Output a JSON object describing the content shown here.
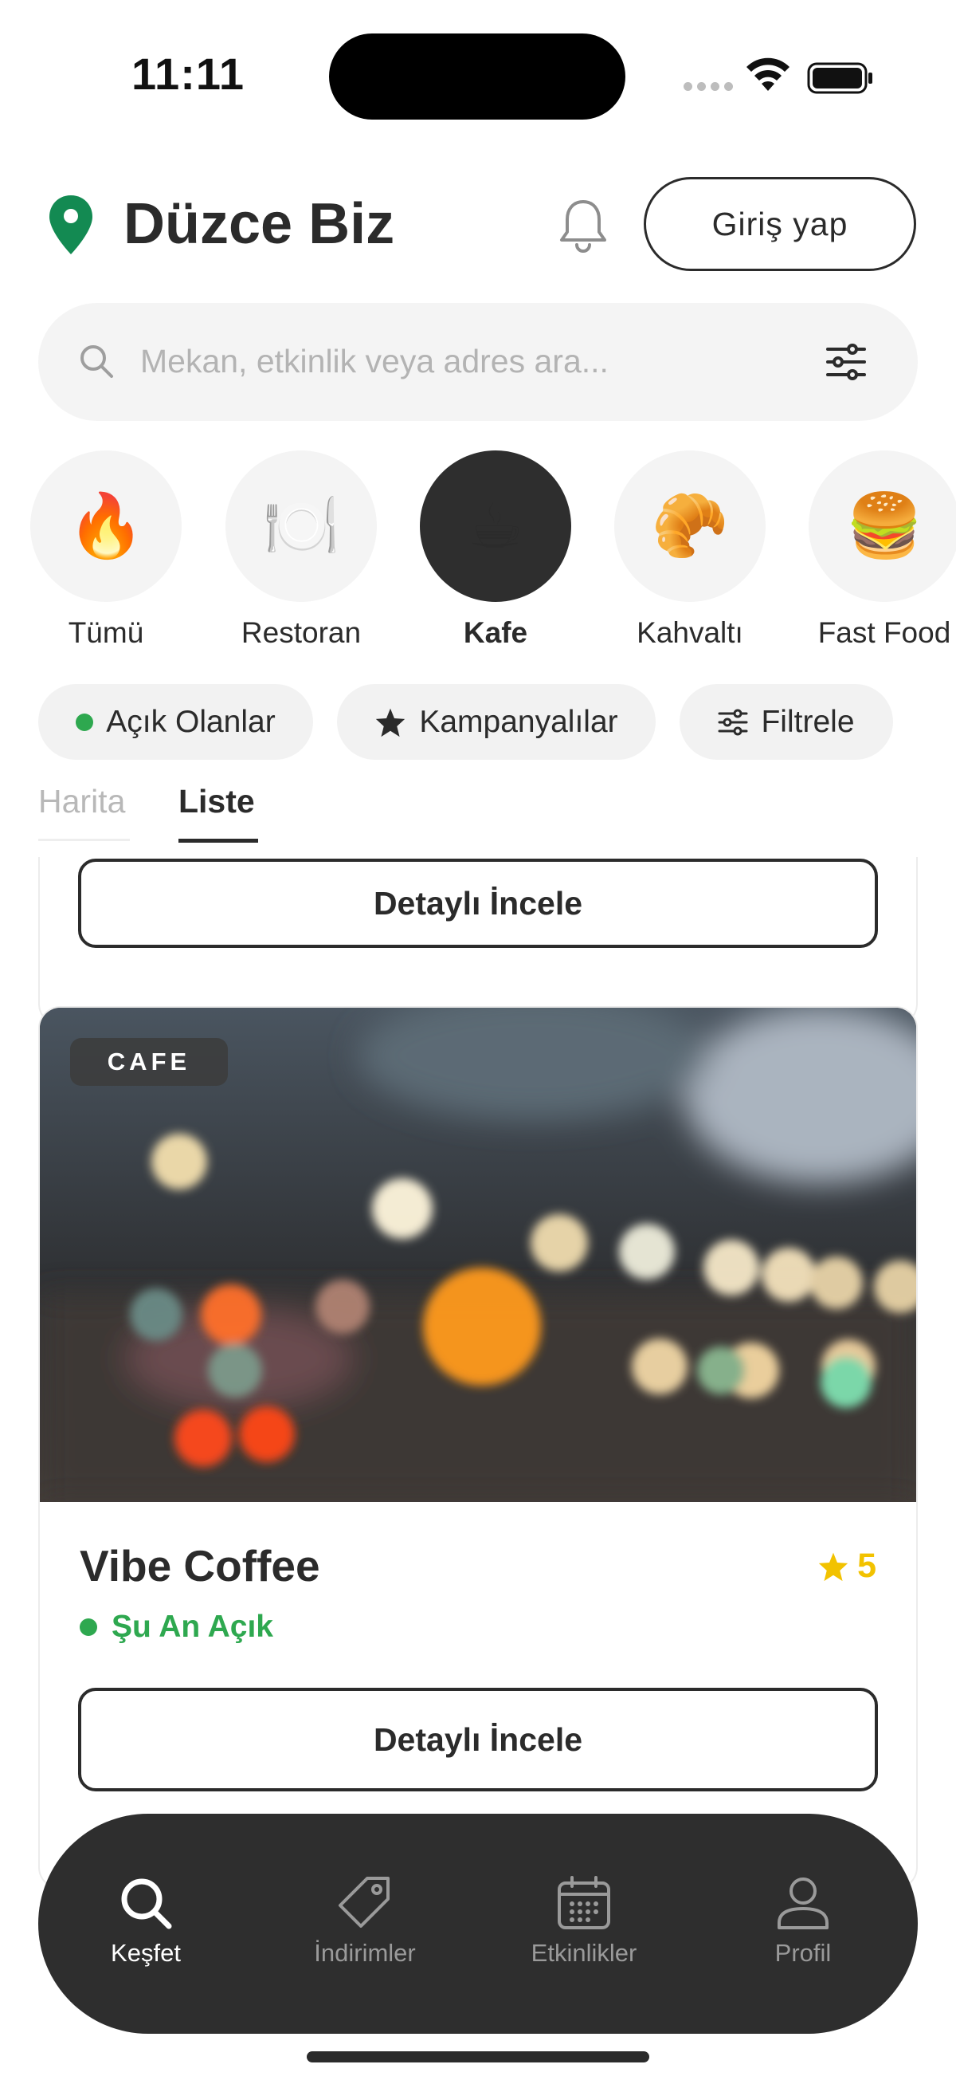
{
  "status_bar": {
    "time": "11:11"
  },
  "header": {
    "brand": "Düzce Biz",
    "login_label": "Giriş yap"
  },
  "search": {
    "placeholder": "Mekan, etkinlik veya adres ara..."
  },
  "categories": [
    {
      "label": "Tümü",
      "emoji": "🔥",
      "active": false
    },
    {
      "label": "Restoran",
      "emoji": "🍽️",
      "active": false
    },
    {
      "label": "Kafe",
      "emoji": "☕",
      "active": true
    },
    {
      "label": "Kahvaltı",
      "emoji": "🥐",
      "active": false
    },
    {
      "label": "Fast Food",
      "emoji": "🍔",
      "active": false
    }
  ],
  "chips": {
    "open_now": "Açık Olanlar",
    "campaigns": "Kampanyalılar",
    "filter": "Filtrele"
  },
  "tabs": {
    "map": "Harita",
    "list": "Liste",
    "active": "Liste"
  },
  "list": {
    "previous_card": {
      "button": "Detaylı İncele"
    },
    "card": {
      "tag": "CAFE",
      "title": "Vibe Coffee",
      "rating": "5",
      "status": "Şu An Açık",
      "button": "Detaylı İncele"
    }
  },
  "colors": {
    "accent_green": "#2ea84f",
    "pin_green": "#138a52",
    "star_yellow": "#f2c200",
    "dark": "#2e2e2e"
  },
  "bottom_nav": [
    {
      "label": "Keşfet",
      "icon": "search-icon",
      "active": true
    },
    {
      "label": "İndirimler",
      "icon": "tag-icon",
      "active": false
    },
    {
      "label": "Etkinlikler",
      "icon": "calendar-icon",
      "active": false
    },
    {
      "label": "Profil",
      "icon": "user-icon",
      "active": false
    }
  ]
}
